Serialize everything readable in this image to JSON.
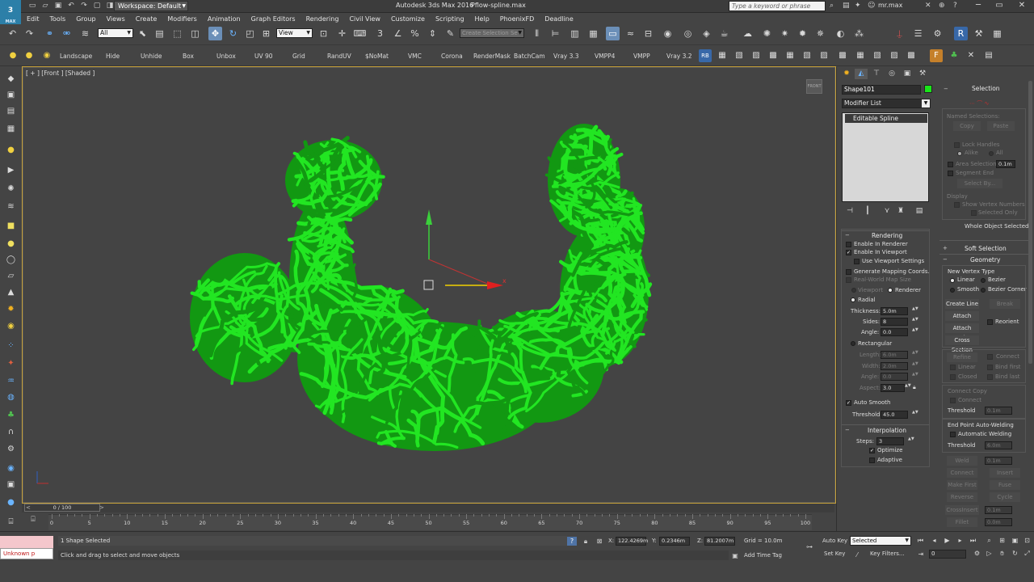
{
  "app": {
    "logo_text": "3",
    "logo_caption": "MAX",
    "workspace": "Workspace: Default",
    "title": "Autodesk 3ds Max 2016",
    "file": "Pflow-spline.max",
    "search_placeholder": "Type a keyword or phrase",
    "user": "mr.max"
  },
  "menu": [
    "Edit",
    "Tools",
    "Group",
    "Views",
    "Create",
    "Modifiers",
    "Animation",
    "Graph Editors",
    "Rendering",
    "Civil View",
    "Customize",
    "Scripting",
    "Help",
    "PhoenixFD",
    "Deadline"
  ],
  "toolbar": {
    "selection_filter": "All",
    "reference_coord": "View",
    "named_selection_placeholder": "Create Selection Se"
  },
  "shelf": [
    "Landscape",
    "Hide",
    "Unhide",
    "Box",
    "Unbox",
    "UV 90",
    "Grid",
    "RandUV",
    "$NoMat",
    "VMC",
    "Corona",
    "RenderMask",
    "BatchCam",
    "Vray 3.3",
    "VMPP4",
    "VMPP",
    "Vray 3.2"
  ],
  "viewport": {
    "label": "[ + ] [Front ] [Shaded ]",
    "viewcube_text": "FRONT",
    "mesh_color": "#22e622",
    "mesh_dark": "#129812"
  },
  "command_panel": {
    "object_name": "Shape101",
    "object_color": "#19e619",
    "modifier_list": "Modifier List",
    "stack_item": "Editable Spline",
    "rendering": {
      "title": "Rendering",
      "enable_in_renderer": "Enable In Renderer",
      "enable_in_viewport": "Enable In Viewport",
      "use_viewport_settings": "Use Viewport Settings",
      "generate_mapping": "Generate Mapping Coords.",
      "real_world_map": "Real-World Map Size",
      "viewport_opt": "Viewport",
      "renderer_opt": "Renderer",
      "radial": "Radial",
      "thickness_label": "Thickness:",
      "thickness": "5.0m",
      "sides_label": "Sides:",
      "sides": "8",
      "angle_label": "Angle:",
      "angle": "0.0",
      "rectangular": "Rectangular",
      "length_label": "Length:",
      "length": "6.0m",
      "width_label": "Width:",
      "width": "2.0m",
      "rect_angle_label": "Angle:",
      "rect_angle": "0.0",
      "aspect_label": "Aspect:",
      "aspect": "3.0",
      "auto_smooth": "Auto Smooth",
      "threshold_label": "Threshold:",
      "threshold": "45.0"
    },
    "interpolation": {
      "title": "Interpolation",
      "steps_label": "Steps:",
      "steps": "3",
      "optimize": "Optimize",
      "adaptive": "Adaptive"
    },
    "selection": {
      "title": "Selection",
      "named_selections": "Named Selections:",
      "copy": "Copy",
      "paste": "Paste",
      "lock_handles": "Lock Handles",
      "alike": "Alike",
      "all": "All",
      "area_selection": "Area Selection:",
      "area_value": "0.1m",
      "segment_end": "Segment End",
      "select_by": "Select By...",
      "display": "Display",
      "show_vertex_numbers": "Show Vertex Numbers",
      "selected_only": "Selected Only",
      "whole_object_selected": "Whole Object Selected"
    },
    "soft_selection": {
      "title": "Soft Selection"
    },
    "geometry": {
      "title": "Geometry",
      "new_vertex_type": "New Vertex Type",
      "linear": "Linear",
      "bezier": "Bezier",
      "smooth": "Smooth",
      "bezier_corner": "Bezier Corner",
      "create_line": "Create Line",
      "break": "Break",
      "attach": "Attach",
      "reorient": "Reorient",
      "attach_mult": "Attach Mult.",
      "cross_section": "Cross Section",
      "refine": "Refine",
      "connect": "Connect",
      "linear2": "Linear",
      "bind_first": "Bind first",
      "closed": "Closed",
      "bind_last": "Bind last",
      "connect_copy": "Connect Copy",
      "connect2": "Connect",
      "threshold_label": "Threshold",
      "threshold_value": "0.1m",
      "end_point_welding": "End Point Auto-Welding",
      "automatic_welding": "Automatic Welding",
      "threshold2_label": "Threshold",
      "threshold2_value": "6.0m",
      "weld": "Weld",
      "weld_value": "0.1m",
      "connect3": "Connect",
      "insert": "Insert",
      "make_first": "Make First",
      "fuse": "Fuse",
      "reverse": "Reverse",
      "cycle": "Cycle",
      "crossinsert": "CrossInsert",
      "crossinsert_value": "0.1m",
      "fillet": "Fillet",
      "fillet_value": "0.0m"
    }
  },
  "timeline": {
    "slider_text": "0 / 100",
    "ticks": [
      "0",
      "5",
      "10",
      "15",
      "20",
      "25",
      "30",
      "35",
      "40",
      "45",
      "50",
      "55",
      "60",
      "65",
      "70",
      "75",
      "80",
      "85",
      "90",
      "95",
      "100"
    ]
  },
  "status": {
    "maxscript_output": "Unknown p",
    "selection": "1 Shape Selected",
    "prompt": "Click and drag to select and move objects",
    "x_label": "X:",
    "x": "122.4269m",
    "y_label": "Y:",
    "y": "0.2346m",
    "z_label": "Z:",
    "z": "81.2007m",
    "grid": "Grid = 10.0m",
    "add_time_tag": "Add Time Tag",
    "auto_key": "Auto Key",
    "set_key": "Set Key",
    "key_mode": "Selected",
    "key_filters": "Key Filters...",
    "frame": "0"
  }
}
